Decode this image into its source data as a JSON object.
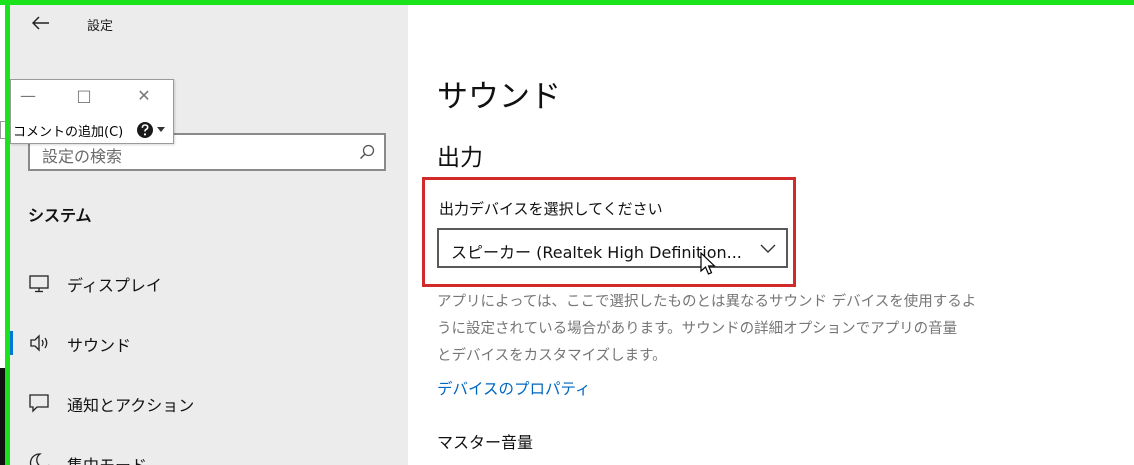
{
  "window": {
    "title": "設定",
    "back_glyph": "←"
  },
  "sidebar": {
    "search_placeholder": "設定の検索",
    "section_title": "システム",
    "items": [
      {
        "label": "ディスプレイ",
        "icon": "monitor-icon"
      },
      {
        "label": "サウンド",
        "icon": "speaker-icon",
        "selected": true
      },
      {
        "label": "通知とアクション",
        "icon": "notification-icon"
      },
      {
        "label": "集中モード",
        "icon": "moon-icon"
      }
    ]
  },
  "comment_toolbar": {
    "minimize_glyph": "—",
    "maximize_glyph": "□",
    "close_glyph": "✕",
    "add_comment_label": "コメントの追加(C)"
  },
  "main": {
    "page_title": "サウンド",
    "output_heading": "出力",
    "device_select_label": "出力デバイスを選択してください",
    "selected_device": "スピーカー (Realtek High Definition...",
    "description_lines": [
      "アプリによっては、ここで選択したものとは異なるサウンド デバイスを使用するよ",
      "うに設定されている場合があります。サウンドの詳細オプションでアプリの音量",
      "とデバイスをカスタマイズします。"
    ],
    "device_properties_link": "デバイスのプロパティ",
    "master_volume_label": "マスター音量"
  },
  "colors": {
    "accent": "#0078d7",
    "link": "#0067c0",
    "highlight_box": "#d12a2a",
    "frame_green": "#1be31b",
    "sidebar_bg": "#ececec"
  }
}
